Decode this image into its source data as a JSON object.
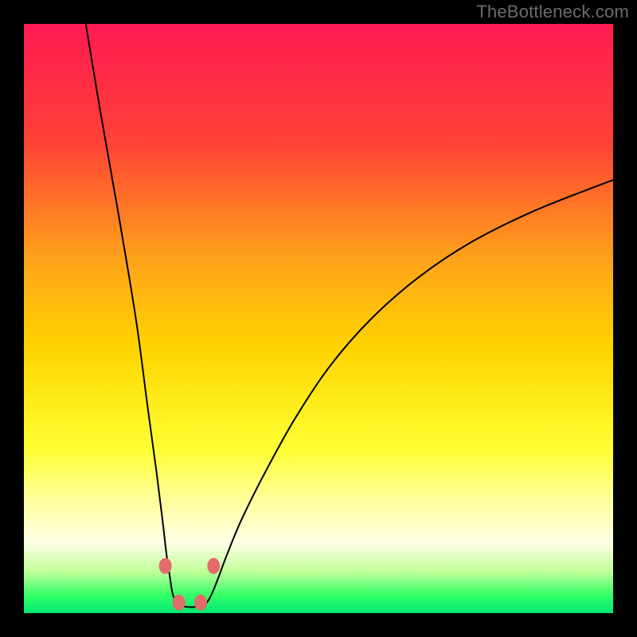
{
  "watermark": "TheBottleneck.com",
  "chart_data": {
    "type": "line",
    "title": "",
    "xlabel": "",
    "ylabel": "",
    "xlim": [
      0,
      100
    ],
    "ylim": [
      0,
      100
    ],
    "grid": false,
    "background_gradient_stops": [
      {
        "offset": 0.0,
        "color": "#ff1a52"
      },
      {
        "offset": 0.2,
        "color": "#ff4236"
      },
      {
        "offset": 0.4,
        "color": "#ffa31a"
      },
      {
        "offset": 0.55,
        "color": "#ffd400"
      },
      {
        "offset": 0.72,
        "color": "#ffff33"
      },
      {
        "offset": 0.82,
        "color": "#ffffaa"
      },
      {
        "offset": 0.88,
        "color": "#ffffe6"
      },
      {
        "offset": 0.93,
        "color": "#bfff99"
      },
      {
        "offset": 0.97,
        "color": "#33ff66"
      },
      {
        "offset": 1.0,
        "color": "#00e676"
      }
    ],
    "series": [
      {
        "name": "left-branch",
        "x": [
          10.5,
          13,
          16,
          19,
          21,
          22.5,
          23.5,
          24.2,
          24.8,
          25.2,
          25.8,
          26.8,
          28.5
        ],
        "y": [
          100,
          85,
          68,
          50,
          35,
          24,
          16,
          10,
          6,
          3.5,
          2,
          1.2,
          1.0
        ]
      },
      {
        "name": "right-branch",
        "x": [
          28.5,
          30.2,
          31.2,
          32,
          33,
          34.5,
          37,
          41,
          46,
          52,
          59,
          67,
          76,
          86,
          96,
          100
        ],
        "y": [
          1.0,
          1.2,
          2,
          3.5,
          6,
          10,
          16,
          24,
          33,
          42,
          50,
          57,
          63,
          68,
          72,
          73.5
        ]
      }
    ],
    "markers": {
      "name": "highlight-dots",
      "color": "#e26b6b",
      "radius_px": 8,
      "points": [
        {
          "x": 24.0,
          "y": 8.0
        },
        {
          "x": 26.3,
          "y": 1.8
        },
        {
          "x": 30.0,
          "y": 1.8
        },
        {
          "x": 32.2,
          "y": 8.0
        }
      ]
    }
  }
}
